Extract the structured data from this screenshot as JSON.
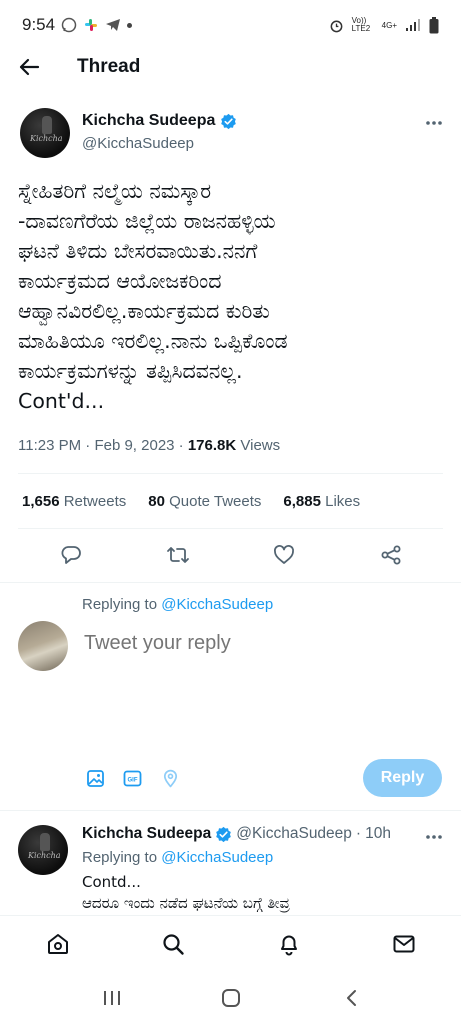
{
  "status_bar": {
    "time": "9:54",
    "network_label": "Vo)) LTE2",
    "network_type": "4G+"
  },
  "header": {
    "title": "Thread"
  },
  "tweet": {
    "author_name": "Kichcha Sudeepa",
    "author_handle": "@KicchaSudeep",
    "avatar_signature": "Kichcha",
    "text": "ಸ್ನೇಹಿತರಿಗೆ ನಲ್ಮೆಯ ನಮಸ್ಕಾರ\n-ದಾವಣಗೆರೆಯ ಜಿಲ್ಲೆಯ ರಾಜನಹಳ್ಳಿಯ\nಘಟನೆ ತಿಳಿದು ಬೇಸರವಾಯಿತು.ನನಗೆ\nಕಾರ್ಯಕ್ರಮದ ಆಯೋಜಕರಿಂದ\nಆಹ್ವಾನವಿರಲಿಲ್ಲ.ಕಾರ್ಯಕ್ರಮದ ಕುರಿತು\nಮಾಹಿತಿಯೂ ಇರಲಿಲ್ಲ.ನಾನು ಒಪ್ಪಿಕೊಂಡ\nಕಾರ್ಯಕ್ರಮಗಳನ್ನು ತಪ್ಪಿಸಿದವನಲ್ಲ.\nCont'd...",
    "time": "11:23 PM",
    "date": "Feb 9, 2023",
    "views_count": "176.8K",
    "views_label": "Views",
    "retweets_count": "1,656",
    "retweets_label": "Retweets",
    "quotes_count": "80",
    "quotes_label": "Quote Tweets",
    "likes_count": "6,885",
    "likes_label": "Likes"
  },
  "composer": {
    "replying_prefix": "Replying to",
    "replying_handle": "@KicchaSudeep",
    "placeholder": "Tweet your reply",
    "reply_button": "Reply",
    "gif_label": "GIF"
  },
  "reply": {
    "author_name": "Kichcha Sudeepa",
    "author_handle": "@KicchaSudeep",
    "age": "10h",
    "replying_prefix": "Replying to",
    "replying_handle": "@KicchaSudeep",
    "text": "Contd...\nಆದರೂ ಇಂದು ನಡೆದ ಘಟನೆಯ ಬಗ್ಗೆ ತೀವ್ರ"
  },
  "colors": {
    "accent": "#1d9bf0",
    "reply_button_disabled": "#8ecdf8",
    "secondary_text": "#536471",
    "primary_text": "#0f1419",
    "divider": "#eff3f4"
  }
}
